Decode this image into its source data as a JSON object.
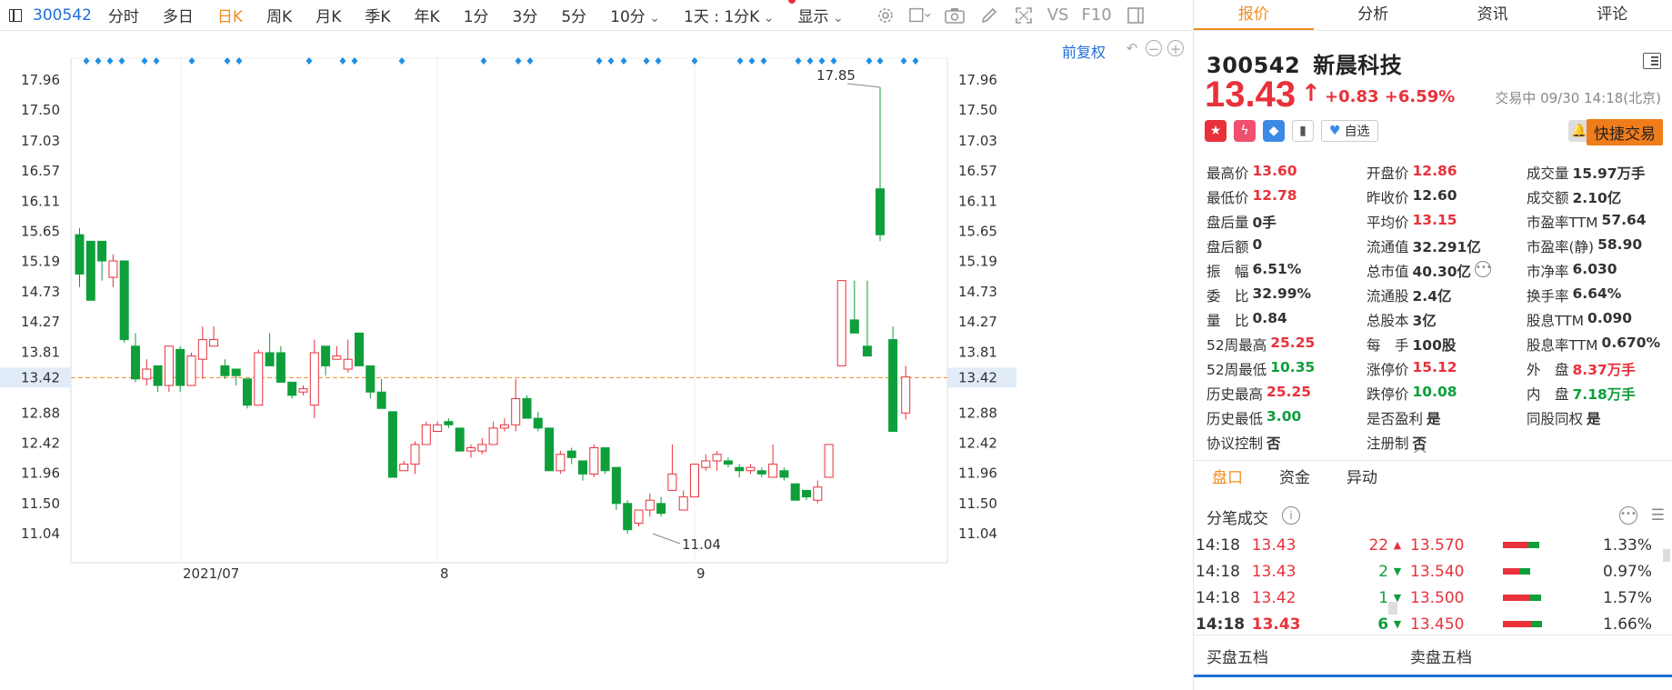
{
  "toolbar": {
    "code": "300542",
    "tabs": [
      "分时",
      "多日",
      "日K",
      "周K",
      "月K",
      "季K",
      "年K",
      "1分",
      "3分",
      "5分",
      "10分"
    ],
    "active_tab": "日K",
    "period_select": "1天 : 1分K",
    "display": "显示",
    "vs_label": "VS",
    "f10_label": "F10"
  },
  "chart_controls": {
    "restore_label": "前复权"
  },
  "chart_data": {
    "type": "candlestick",
    "y_ticks": [
      17.96,
      17.5,
      17.03,
      16.57,
      16.11,
      15.65,
      15.19,
      14.73,
      14.27,
      13.81,
      13.42,
      12.88,
      12.42,
      11.96,
      11.5,
      11.04
    ],
    "x_labels": [
      "2021/07",
      "8",
      "9"
    ],
    "current_price_label": "13.42",
    "max_label": "17.85",
    "min_label": "11.04",
    "candles": [
      [
        15.6,
        15.0,
        15.7,
        14.8
      ],
      [
        15.5,
        14.6,
        15.5,
        14.6
      ],
      [
        15.5,
        15.2,
        15.5,
        14.9
      ],
      [
        14.95,
        15.2,
        15.3,
        14.8
      ],
      [
        15.2,
        14.0,
        15.2,
        13.95
      ],
      [
        13.9,
        13.4,
        14.1,
        13.35
      ],
      [
        13.4,
        13.55,
        13.7,
        13.3
      ],
      [
        13.6,
        13.3,
        13.6,
        13.2
      ],
      [
        13.3,
        13.9,
        13.9,
        13.2
      ],
      [
        13.85,
        13.3,
        13.9,
        13.2
      ],
      [
        13.3,
        13.75,
        13.8,
        13.3
      ],
      [
        13.7,
        14.0,
        14.2,
        13.4
      ],
      [
        13.9,
        14.0,
        14.2,
        13.9
      ],
      [
        13.6,
        13.45,
        13.7,
        13.4
      ],
      [
        13.55,
        13.45,
        13.55,
        13.3
      ],
      [
        13.4,
        13.0,
        13.4,
        12.95
      ],
      [
        13.0,
        13.8,
        13.85,
        13.0
      ],
      [
        13.8,
        13.6,
        14.1,
        13.6
      ],
      [
        13.8,
        13.35,
        13.9,
        13.35
      ],
      [
        13.35,
        13.15,
        13.35,
        13.1
      ],
      [
        13.2,
        13.25,
        13.3,
        13.15
      ],
      [
        13.0,
        13.8,
        14.0,
        12.8
      ],
      [
        13.9,
        13.6,
        13.9,
        13.45
      ],
      [
        13.7,
        13.75,
        13.9,
        13.7
      ],
      [
        13.55,
        13.7,
        14.0,
        13.5
      ],
      [
        14.1,
        13.6,
        14.1,
        13.6
      ],
      [
        13.6,
        13.2,
        13.6,
        13.1
      ],
      [
        13.2,
        12.95,
        13.4,
        12.95
      ],
      [
        12.9,
        11.9,
        12.9,
        11.9
      ],
      [
        12.0,
        12.1,
        12.15,
        12.0
      ],
      [
        12.1,
        12.4,
        12.45,
        11.95
      ],
      [
        12.4,
        12.7,
        12.75,
        12.4
      ],
      [
        12.6,
        12.7,
        12.75,
        12.6
      ],
      [
        12.75,
        12.7,
        12.8,
        12.65
      ],
      [
        12.65,
        12.3,
        12.65,
        12.3
      ],
      [
        12.3,
        12.35,
        12.4,
        12.2
      ],
      [
        12.3,
        12.4,
        12.5,
        12.25
      ],
      [
        12.4,
        12.65,
        12.75,
        12.4
      ],
      [
        12.65,
        12.7,
        12.8,
        12.6
      ],
      [
        12.7,
        13.1,
        13.4,
        12.6
      ],
      [
        13.1,
        12.8,
        13.15,
        12.8
      ],
      [
        12.8,
        12.65,
        12.9,
        12.6
      ],
      [
        12.65,
        12.0,
        12.65,
        12.0
      ],
      [
        12.0,
        12.25,
        12.3,
        11.95
      ],
      [
        12.3,
        12.2,
        12.35,
        12.1
      ],
      [
        12.15,
        11.95,
        12.15,
        11.85
      ],
      [
        11.95,
        12.35,
        12.4,
        11.9
      ],
      [
        12.35,
        12.0,
        12.35,
        11.95
      ],
      [
        12.05,
        11.5,
        12.05,
        11.4
      ],
      [
        11.5,
        11.1,
        11.55,
        11.04
      ],
      [
        11.2,
        11.4,
        11.4,
        11.15
      ],
      [
        11.4,
        11.55,
        11.65,
        11.3
      ],
      [
        11.5,
        11.35,
        11.6,
        11.3
      ],
      [
        11.7,
        11.95,
        12.4,
        11.7
      ],
      [
        11.4,
        11.6,
        11.7,
        11.4
      ],
      [
        11.6,
        12.1,
        12.1,
        11.6
      ],
      [
        12.05,
        12.15,
        12.25,
        12.0
      ],
      [
        12.15,
        12.25,
        12.3,
        12.0
      ],
      [
        12.15,
        12.1,
        12.2,
        12.05
      ],
      [
        12.05,
        12.0,
        12.1,
        11.9
      ],
      [
        12.0,
        12.05,
        12.1,
        11.95
      ],
      [
        12.0,
        11.95,
        12.05,
        11.9
      ],
      [
        11.9,
        12.1,
        12.4,
        11.9
      ],
      [
        12.0,
        11.9,
        12.05,
        11.85
      ],
      [
        11.8,
        11.55,
        11.8,
        11.55
      ],
      [
        11.7,
        11.6,
        11.7,
        11.55
      ],
      [
        11.55,
        11.75,
        11.85,
        11.5
      ],
      [
        11.9,
        12.4,
        12.4,
        11.9
      ],
      [
        13.6,
        14.9,
        14.9,
        13.6
      ],
      [
        14.3,
        14.1,
        14.9,
        14.1
      ],
      [
        13.9,
        13.75,
        14.9,
        13.75
      ],
      [
        16.3,
        15.6,
        17.85,
        15.5
      ],
      [
        14.0,
        12.6,
        14.2,
        12.6
      ],
      [
        12.88,
        13.43,
        13.6,
        12.78
      ]
    ],
    "dot_rows": "2021/07 .. 2021/09 daily markers"
  },
  "right": {
    "tabs": [
      "报价",
      "分析",
      "资讯",
      "评论"
    ],
    "active_tab": "报价",
    "code": "300542",
    "name": "新晨科技",
    "price": "13.43",
    "change": "+0.83",
    "change_pct": "+6.59%",
    "status": "交易中 09/30 14:18(北京)",
    "watch_label": "自选",
    "quick_trade": "快捷交易",
    "quote_rows": [
      [
        [
          "最高价",
          "13.60",
          "red"
        ],
        [
          "开盘价",
          "12.86",
          "red"
        ],
        [
          "成交量",
          "15.97万手",
          ""
        ]
      ],
      [
        [
          "最低价",
          "12.78",
          "red"
        ],
        [
          "昨收价",
          "12.60",
          ""
        ],
        [
          "成交额",
          "2.10亿",
          ""
        ]
      ],
      [
        [
          "盘后量",
          "0手",
          ""
        ],
        [
          "平均价",
          "13.15",
          "red"
        ],
        [
          "市盈率TTM",
          "57.64",
          ""
        ]
      ],
      [
        [
          "盘后额",
          "0",
          ""
        ],
        [
          "流通值",
          "32.291亿",
          ""
        ],
        [
          "市盈率(静)",
          "58.90",
          ""
        ]
      ],
      [
        [
          "振　幅",
          "6.51%",
          ""
        ],
        [
          "总市值",
          "40.30亿",
          ""
        ],
        [
          "市净率",
          "6.030",
          ""
        ]
      ],
      [
        [
          "委　比",
          "32.99%",
          ""
        ],
        [
          "流通股",
          "2.4亿",
          ""
        ],
        [
          "换手率",
          "6.64%",
          ""
        ]
      ],
      [
        [
          "量　比",
          "0.84",
          ""
        ],
        [
          "总股本",
          "3亿",
          ""
        ],
        [
          "股息TTM",
          "0.090",
          ""
        ]
      ],
      [
        [
          "52周最高",
          "25.25",
          "red"
        ],
        [
          "每　手",
          "100股",
          ""
        ],
        [
          "股息率TTM",
          "0.670%",
          ""
        ]
      ],
      [
        [
          "52周最低",
          "10.35",
          "green"
        ],
        [
          "涨停价",
          "15.12",
          "red"
        ],
        [
          "外　盘",
          "8.37万手",
          "red"
        ]
      ],
      [
        [
          "历史最高",
          "25.25",
          "red"
        ],
        [
          "跌停价",
          "10.08",
          "green"
        ],
        [
          "内　盘",
          "7.18万手",
          "green"
        ]
      ],
      [
        [
          "历史最低",
          "3.00",
          "green"
        ],
        [
          "是否盈利",
          "是",
          ""
        ],
        [
          "同股同权",
          "是",
          ""
        ]
      ],
      [
        [
          "协议控制",
          "否",
          ""
        ],
        [
          "注册制",
          "否",
          ""
        ],
        [
          "",
          "",
          ""
        ]
      ]
    ],
    "sub_tabs": [
      "盘口",
      "资金",
      "异动"
    ],
    "active_sub_tab": "盘口",
    "tick_title": "分笔成交",
    "ticks": [
      [
        "14:18",
        "13.43",
        "22",
        "up"
      ],
      [
        "14:18",
        "13.43",
        "2",
        "down"
      ],
      [
        "14:18",
        "13.42",
        "1",
        "down"
      ],
      [
        "14:18",
        "13.43",
        "6",
        "down"
      ]
    ],
    "depth": [
      [
        "13.570",
        "1.33%",
        0.7
      ],
      [
        "13.540",
        "0.97%",
        0.45
      ],
      [
        "13.500",
        "1.57%",
        0.75
      ],
      [
        "13.450",
        "1.66%",
        0.78
      ]
    ],
    "buy5": "买盘五档",
    "sell5": "卖盘五档"
  },
  "colors": {
    "up": "#e8313b",
    "down": "#0e9f3b",
    "accent": "#f28c1e",
    "link": "#1e6fd9"
  }
}
